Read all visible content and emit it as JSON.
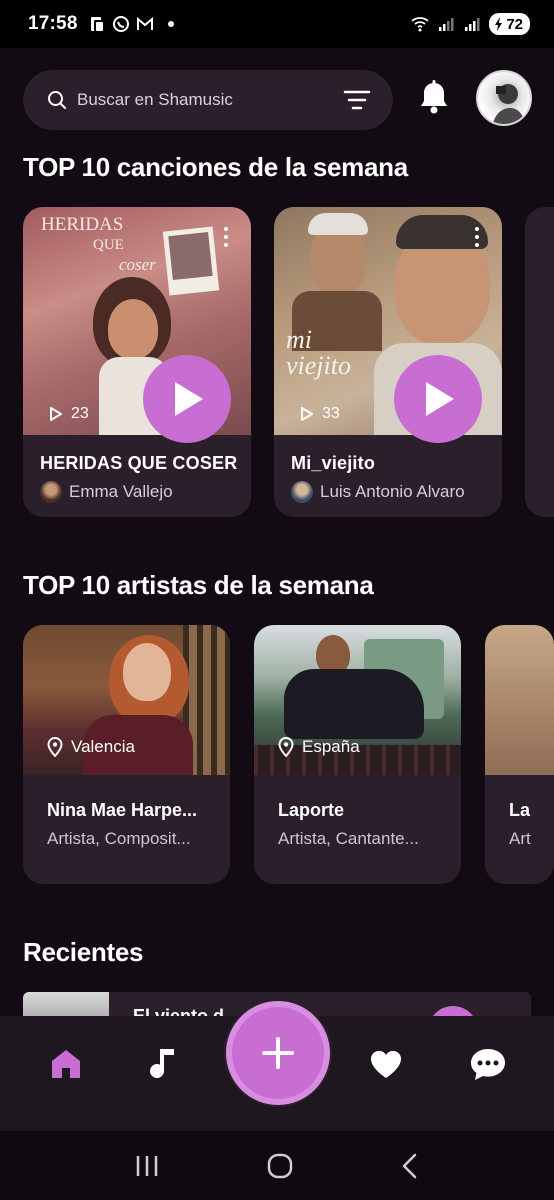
{
  "status_bar": {
    "time": "17:58",
    "battery": "72"
  },
  "search": {
    "placeholder": "Buscar en Shamusic"
  },
  "sections": {
    "top_songs": "TOP 10 canciones de la semana",
    "top_artists": "TOP 10 artistas de la semana",
    "recent": "Recientes"
  },
  "songs": [
    {
      "title": "HERIDAS QUE COSER",
      "artist": "Emma Vallejo",
      "plays": "23",
      "cover_text_line1": "HERIDAS",
      "cover_text_line2": "QUE",
      "cover_text_line3": "coser"
    },
    {
      "title": "Mi_viejito",
      "artist": "Luis Antonio Alvaro",
      "plays": "33",
      "cover_text_line1": "mi",
      "cover_text_line2": "viejito"
    }
  ],
  "artists": [
    {
      "name": "Nina Mae Harpe...",
      "role": "Artista, Composit...",
      "location": "Valencia"
    },
    {
      "name": "Laporte",
      "role": "Artista, Cantante...",
      "location": "España"
    },
    {
      "name": "La",
      "role": "Art",
      "location": ""
    }
  ],
  "recent": [
    {
      "title": "El viento d..."
    }
  ],
  "colors": {
    "accent": "#c86ed3",
    "card": "#2a1f2b",
    "background": "#120b13"
  },
  "icons": {
    "nav": [
      "home-icon",
      "music-note-icon",
      "plus-icon",
      "heart-icon",
      "chat-icon"
    ]
  }
}
